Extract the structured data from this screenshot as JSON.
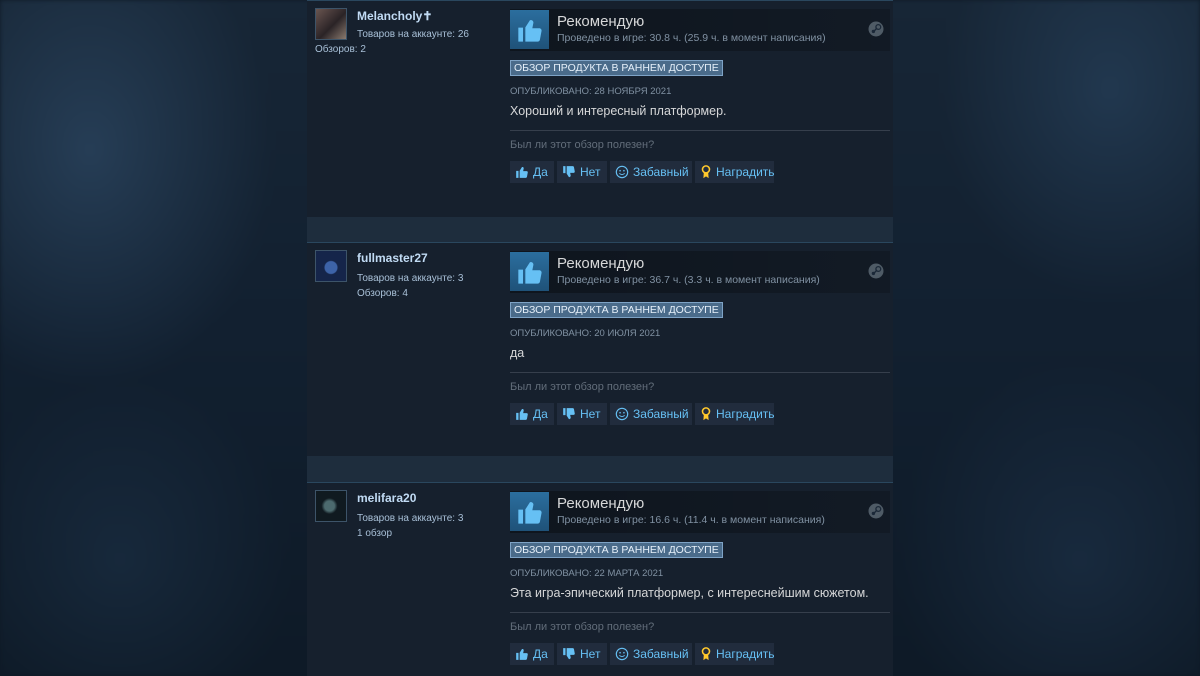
{
  "reviews": [
    {
      "author": "Melancholy✝",
      "products": "Товаров на аккаунте: 26",
      "reviews_count": "Обзоров: 2",
      "verdict": "Рекомендую",
      "hours": "Проведено в игре: 30.8 ч. (25.9 ч. в момент написания)",
      "badge": "ОБЗОР ПРОДУКТА В РАННЕМ ДОСТУПЕ",
      "posted": "ОПУБЛИКОВАНО: 28 НОЯБРЯ 2021",
      "text": "Хороший и интересный платформер."
    },
    {
      "author": "fullmaster27",
      "products": "Товаров на аккаунте: 3",
      "reviews_count": "Обзоров: 4",
      "verdict": "Рекомендую",
      "hours": "Проведено в игре: 36.7 ч. (3.3 ч. в момент написания)",
      "badge": "ОБЗОР ПРОДУКТА В РАННЕМ ДОСТУПЕ",
      "posted": "ОПУБЛИКОВАНО: 20 ИЮЛЯ 2021",
      "text": "да"
    },
    {
      "author": "melifara20",
      "products": "Товаров на аккаунте: 3",
      "reviews_count": "1 обзор",
      "verdict": "Рекомендую",
      "hours": "Проведено в игре: 16.6 ч. (11.4 ч. в момент написания)",
      "badge": "ОБЗОР ПРОДУКТА В РАННЕМ ДОСТУПЕ",
      "posted": "ОПУБЛИКОВАНО: 22 МАРТА 2021",
      "text": "Эта игра-эпический платформер, с интереснейшим сюжетом."
    }
  ],
  "helpful_prompt": "Был ли этот обзор полезен?",
  "buttons": {
    "yes": "Да",
    "no": "Нет",
    "funny": "Забавный",
    "award": "Наградить"
  },
  "colors": {
    "accent": "#66c0f4",
    "award": "#ffc82c",
    "thumb": "#66c0f4"
  },
  "icons": [
    "thumbs-up-icon",
    "thumbs-down-icon",
    "smiley-icon",
    "award-icon",
    "steam-icon"
  ]
}
